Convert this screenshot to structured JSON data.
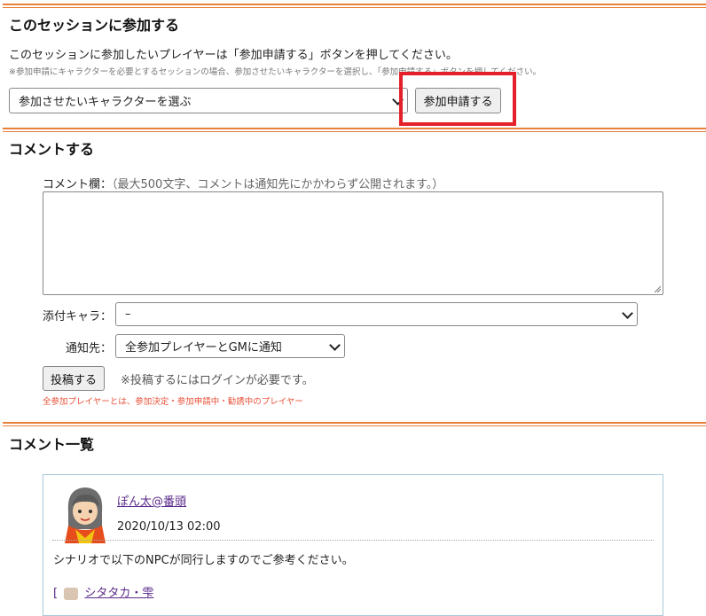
{
  "join": {
    "title": "このセッションに参加する",
    "description": "このセッションに参加したいプレイヤーは「参加申請する」ボタンを押してください。",
    "note": "※参加申請にキャラクターを必要とするセッションの場合、参加させたいキャラクターを選択し、「参加申請する」ボタンを押してください。",
    "character_select": "参加させたいキャラクターを選ぶ",
    "apply_button": "参加申請する"
  },
  "comment_form": {
    "title": "コメントする",
    "comment_label": "コメント欄：",
    "comment_hint": "（最大500文字、コメントは通知先にかかわらず公開されます。）",
    "attach_label": "添付キャラ：",
    "attach_value": "–",
    "notify_label": "通知先：",
    "notify_value": "全参加プレイヤーとGMに通知",
    "post_button": "投稿する",
    "login_note": "※投稿するにはログインが必要です。",
    "players_note": "全参加プレイヤーとは、参加決定・参加申請中・勧誘中のプレイヤー"
  },
  "comment_list": {
    "title": "コメント一覧",
    "comments": [
      {
        "author": "ぽん太@番頭",
        "date": "2020/10/13 02:00",
        "body": "シナリオで以下のNPCが同行しますのでご参考ください。",
        "ref_open": "[",
        "ref_text": "シタタカ・雫"
      }
    ]
  },
  "colors": {
    "accent_rule": "#e8803a",
    "highlight": "#e4202b",
    "warning_text": "#e8523a",
    "link": "#5a2a8a"
  }
}
